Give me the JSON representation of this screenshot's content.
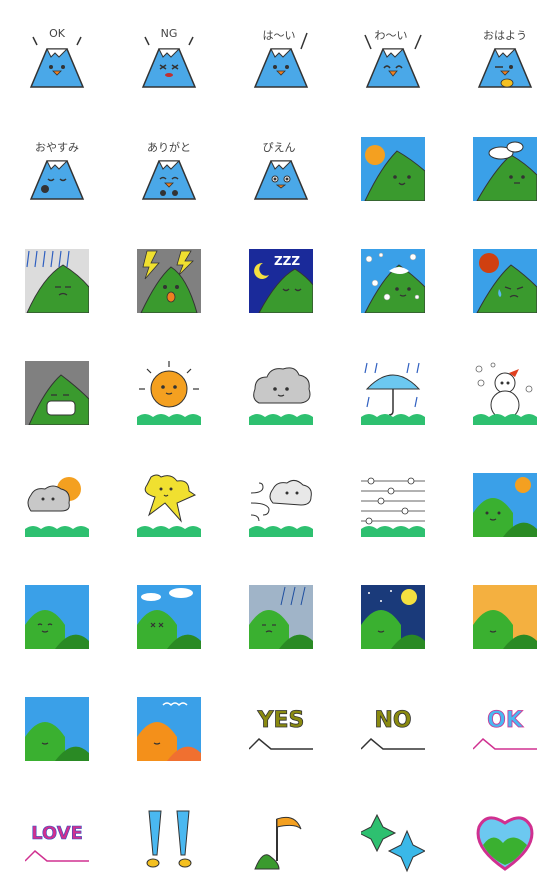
{
  "stickers": {
    "ok_fuji": {
      "text": "OK"
    },
    "ng_fuji": {
      "text": "NG"
    },
    "haai_fuji": {
      "text": "は〜い"
    },
    "waai_fuji": {
      "text": "わ〜い"
    },
    "ohayou_fuji": {
      "text": "おはよう"
    },
    "oyasumi_fuji": {
      "text": "おやすみ"
    },
    "arigato_fuji": {
      "text": "ありがと"
    },
    "pien_fuji": {
      "text": "ぴえん"
    },
    "zzz": {
      "text": "ZZZ"
    },
    "yes_word": {
      "text": "YES"
    },
    "no_word": {
      "text": "NO"
    },
    "ok_word": {
      "text": "OK"
    },
    "love_word": {
      "text": "LOVE"
    }
  },
  "colors": {
    "fuji_blue": "#4aa8e8",
    "snow": "#ffffff",
    "green": "#3a9a2e",
    "sky": "#3aa0e8",
    "sun": "#f4a020",
    "outline": "#333333"
  }
}
